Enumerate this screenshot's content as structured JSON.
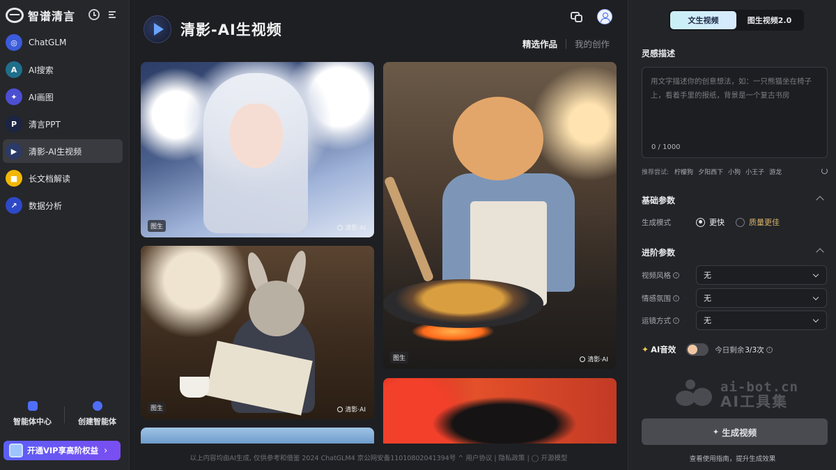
{
  "app": {
    "brand": "智谱清言"
  },
  "sidebar": {
    "items": [
      {
        "label": "ChatGLM",
        "icon": "chatglm-icon",
        "color": "#3b5bdb",
        "glyph": "◎"
      },
      {
        "label": "AI搜索",
        "icon": "ai-search-icon",
        "color": "#1f6f8b",
        "glyph": "A"
      },
      {
        "label": "AI画图",
        "icon": "ai-draw-icon",
        "color": "#4c4fd1",
        "glyph": "✦"
      },
      {
        "label": "清言PPT",
        "icon": "ppt-icon",
        "color": "#1c2444",
        "glyph": "P"
      },
      {
        "label": "清影-AI生视频",
        "icon": "video-icon",
        "color": "#2b3a66",
        "glyph": "▶",
        "active": true
      },
      {
        "label": "长文档解读",
        "icon": "document-icon",
        "color": "#f2b705",
        "glyph": "■"
      },
      {
        "label": "数据分析",
        "icon": "data-analysis-icon",
        "color": "#2e49c8",
        "glyph": "↗"
      }
    ],
    "agent_center": "智能体中心",
    "create_agent": "创建智能体",
    "vip": "开通VIP享高阶权益"
  },
  "header": {
    "title": "清影-AI生视频",
    "tabs": [
      {
        "label": "精选作品",
        "active": true
      },
      {
        "label": "我的创作",
        "active": false
      }
    ]
  },
  "gallery": {
    "cards": [
      {
        "badge": "图生",
        "watermark": "清影·AI"
      },
      {
        "badge": "图生",
        "watermark": "清影·AI"
      },
      {
        "badge": "图生",
        "watermark": "清影·AI"
      }
    ]
  },
  "footer": {
    "text": "以上内容均由AI生成, 仅供参考和借鉴 2024 ChatGLM4 京公网安备11010802041394号 ^ 用户协议 | 隐私政策 | ◯ 开源模型"
  },
  "panel": {
    "modes": [
      {
        "label": "文生视频",
        "active": true
      },
      {
        "label": "图生视频2.0",
        "active": false
      }
    ],
    "prompt_section": "灵感描述",
    "prompt_placeholder": "用文字描述你的创意想法，如：一只熊猫坐在椅子上，看着手里的报纸，背景是一个复古书房",
    "prompt_value": "",
    "counter": "0 / 1000",
    "suggest_label": "推荐尝试:",
    "suggestions": [
      "柠檬狗",
      "夕阳西下",
      "小狗",
      "小王子",
      "游龙"
    ],
    "basic_section": "基础参数",
    "gen_mode_label": "生成模式",
    "gen_modes": [
      {
        "label": "更快",
        "checked": true
      },
      {
        "label": "质量更佳",
        "checked": false
      }
    ],
    "advanced_section": "进阶参数",
    "params": [
      {
        "label": "视频风格",
        "value": "无"
      },
      {
        "label": "情感氛围",
        "value": "无"
      },
      {
        "label": "运镜方式",
        "value": "无"
      }
    ],
    "ai_sound_label": "AI音效",
    "ai_sound_on": false,
    "quota_prefix": "今日剩余",
    "quota_value": "3/3次",
    "watermark_line1": "ai-bot.cn",
    "watermark_line2": "AI工具集",
    "generate_button": "生成视频",
    "guide_link": "查看使用指南，提升生成效果"
  }
}
